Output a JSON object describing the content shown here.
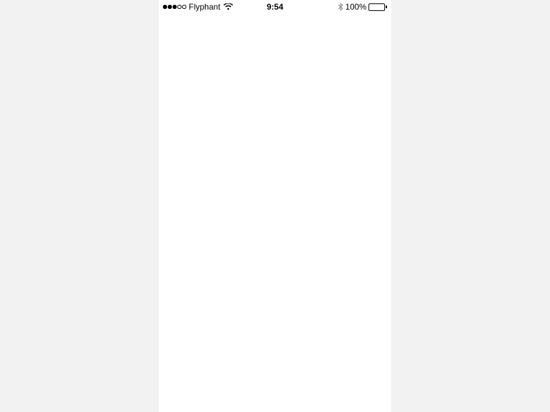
{
  "status_bar": {
    "carrier": "Flyphant",
    "signal_strength": 3,
    "signal_max": 5,
    "time": "9:54",
    "battery_percent": "100%",
    "icons": {
      "wifi": "wifi-icon",
      "bluetooth": "bluetooth-icon",
      "battery": "battery-icon"
    }
  }
}
